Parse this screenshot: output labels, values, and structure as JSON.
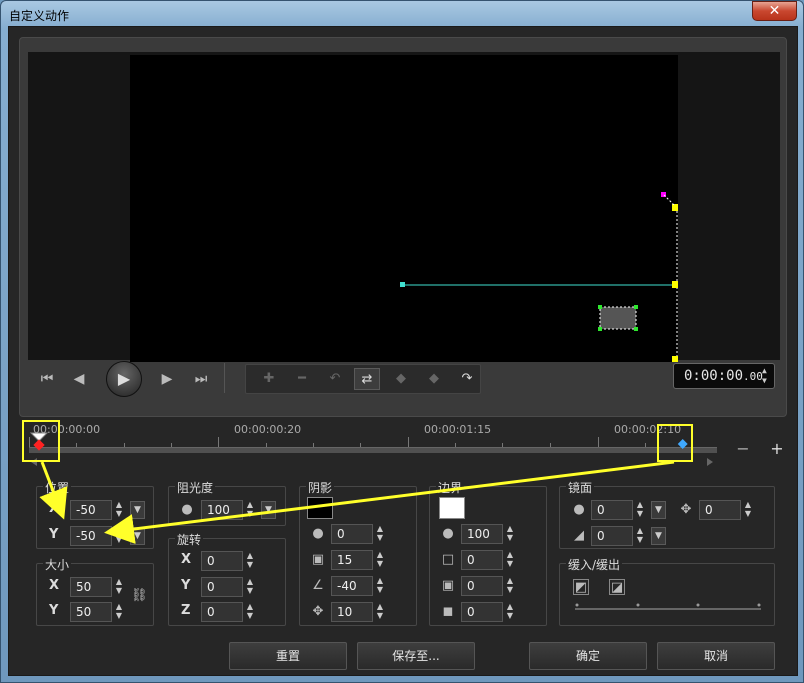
{
  "window": {
    "title": "自定义动作",
    "close_glyph": "✕"
  },
  "transport": {
    "icons": [
      "skip-to-start",
      "step-back",
      "play",
      "step-forward",
      "skip-to-end"
    ],
    "timecode_main": "0:00:00",
    "timecode_frames": ".00"
  },
  "toolbar": {
    "icons": [
      "add-keyframe",
      "remove-keyframe",
      "reverse",
      "swap",
      "prev-keyframe",
      "next-keyframe",
      "copy-paste"
    ]
  },
  "timeline": {
    "labels": [
      "00:00:00:00",
      "00:00:00:20",
      "00:00:01:15",
      "00:00:02:10"
    ],
    "zoom_out_glyph": "−",
    "zoom_in_glyph": "+"
  },
  "position": {
    "label": "位置",
    "x_label": "X",
    "y_label": "Y",
    "x": "-50",
    "y": "-50"
  },
  "size": {
    "label": "大小",
    "x_label": "X",
    "y_label": "Y",
    "x": "50",
    "y": "50"
  },
  "opacity": {
    "label": "阻光度",
    "value": "100"
  },
  "rotation": {
    "label": "旋转",
    "x_label": "X",
    "y_label": "Y",
    "z_label": "Z",
    "x": "0",
    "y": "0",
    "z": "0"
  },
  "shadow": {
    "label": "阴影",
    "opacity": "0",
    "blur": "15",
    "angle": "-40",
    "distance": "10"
  },
  "border": {
    "label": "边界",
    "opacity": "100",
    "v1": "0",
    "v2": "0",
    "v3": "0"
  },
  "mirror": {
    "label": "镜面",
    "v1": "0",
    "v2": "0",
    "v3": "0"
  },
  "easing": {
    "label": "缓入/缓出"
  },
  "buttons": {
    "reset": "重置",
    "save_as": "保存至...",
    "ok": "确定",
    "cancel": "取消"
  },
  "colors": {
    "highlight": "#ffff2a",
    "cyan": "#40e0d0",
    "magenta": "#ff00ff",
    "yellow_handle": "#ffff00"
  }
}
